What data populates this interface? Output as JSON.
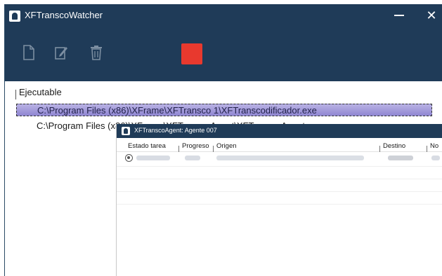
{
  "window": {
    "title": "XFTranscoWatcher",
    "close_glyph": "✕",
    "colors": {
      "titlebar": "#1f3b58",
      "stop": "#e8392e",
      "selection": "#9d95d8"
    }
  },
  "toolbar": {
    "icons": [
      "file-icon",
      "edit-icon",
      "trash-icon",
      "stop-button"
    ]
  },
  "list": {
    "column_header": "Ejecutable",
    "rows": [
      {
        "path": "C:\\Program Files (x86)\\XFrame\\XFTransco 1\\XFTranscodificador.exe",
        "selected": true
      },
      {
        "path": "C:\\Program Files (x86)\\XFrame\\XFTranscoAgent\\XFTranscoAgent.exe",
        "selected": false
      }
    ]
  },
  "agent": {
    "title": "XFTranscoAgent: Agente 007",
    "columns": [
      "Estado tarea",
      "Progreso",
      "Origen",
      "Destino",
      "No"
    ]
  }
}
